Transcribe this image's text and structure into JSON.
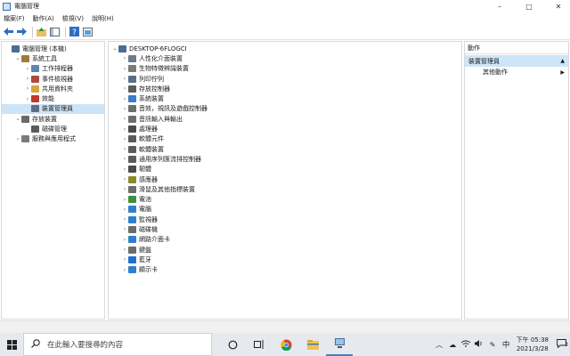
{
  "window": {
    "title": "電腦管理"
  },
  "menubar": {
    "items": [
      "檔案(F)",
      "動作(A)",
      "檢視(V)",
      "說明(H)"
    ]
  },
  "left_tree": [
    {
      "label": "電腦管理 (本機)",
      "level": 0,
      "expand": "",
      "icon": "computer-management-icon"
    },
    {
      "label": "系統工具",
      "level": 1,
      "expand": "open",
      "icon": "tools-icon"
    },
    {
      "label": "工作排程器",
      "level": 2,
      "expand": "closed",
      "icon": "task-scheduler-icon"
    },
    {
      "label": "事件檢視器",
      "level": 2,
      "expand": "closed",
      "icon": "event-viewer-icon"
    },
    {
      "label": "共用資料夾",
      "level": 2,
      "expand": "closed",
      "icon": "shared-folders-icon"
    },
    {
      "label": "效能",
      "level": 2,
      "expand": "closed",
      "icon": "performance-icon"
    },
    {
      "label": "裝置管理員",
      "level": 2,
      "expand": "",
      "icon": "device-manager-icon",
      "selected": true
    },
    {
      "label": "存放裝置",
      "level": 1,
      "expand": "open",
      "icon": "storage-icon"
    },
    {
      "label": "磁碟管理",
      "level": 2,
      "expand": "",
      "icon": "disk-management-icon"
    },
    {
      "label": "服務與應用程式",
      "level": 1,
      "expand": "closed",
      "icon": "services-icon"
    }
  ],
  "device_tree": {
    "root": "DESKTOP-6FLOGCI",
    "items": [
      {
        "label": "人性化介面裝置",
        "icon": "hid-icon",
        "color": "#6b7a8f"
      },
      {
        "label": "生物特徵辨識裝置",
        "icon": "biometric-icon",
        "color": "#7a7a7a"
      },
      {
        "label": "列印佇列",
        "icon": "printer-icon",
        "color": "#5a6f86"
      },
      {
        "label": "存放控制器",
        "icon": "storage-controller-icon",
        "color": "#5c5c5c"
      },
      {
        "label": "系統裝置",
        "icon": "system-device-icon",
        "color": "#3d7cc9"
      },
      {
        "label": "音效，視訊及遊戲控制器",
        "icon": "audio-icon",
        "color": "#6e6e6e"
      },
      {
        "label": "音訊輸入與輸出",
        "icon": "audio-io-icon",
        "color": "#6e6e6e"
      },
      {
        "label": "處理器",
        "icon": "processor-icon",
        "color": "#4a4a4a"
      },
      {
        "label": "軟體元件",
        "icon": "software-component-icon",
        "color": "#5b5b5b"
      },
      {
        "label": "軟體裝置",
        "icon": "software-device-icon",
        "color": "#5b5b5b"
      },
      {
        "label": "通用序列匯流排控制器",
        "icon": "usb-icon",
        "color": "#5b5b5b"
      },
      {
        "label": "韌體",
        "icon": "firmware-icon",
        "color": "#4a4a4a"
      },
      {
        "label": "感應器",
        "icon": "sensor-icon",
        "color": "#8a8a2a"
      },
      {
        "label": "滑鼠及其他指標裝置",
        "icon": "mouse-icon",
        "color": "#6b6b6b"
      },
      {
        "label": "電池",
        "icon": "battery-icon",
        "color": "#3f8f3f"
      },
      {
        "label": "電腦",
        "icon": "computer-icon",
        "color": "#2f7fd0"
      },
      {
        "label": "監視器",
        "icon": "monitor-icon",
        "color": "#2f7fd0"
      },
      {
        "label": "磁碟機",
        "icon": "disk-drive-icon",
        "color": "#6b6b6b"
      },
      {
        "label": "網路介面卡",
        "icon": "network-adapter-icon",
        "color": "#2f7fd0"
      },
      {
        "label": "鍵盤",
        "icon": "keyboard-icon",
        "color": "#6b6b6b"
      },
      {
        "label": "藍牙",
        "icon": "bluetooth-icon",
        "color": "#1e6fd0"
      },
      {
        "label": "顯示卡",
        "icon": "display-adapter-icon",
        "color": "#2f7fd0"
      }
    ]
  },
  "actions": {
    "header": "動作",
    "section": "裝置管理員",
    "items": [
      "其他動作"
    ]
  },
  "taskbar": {
    "search_placeholder": "在此輸入要搜尋的內容",
    "time": "下午 05:38",
    "date": "2021/3/28",
    "ime": "中",
    "notification_count": "3"
  }
}
